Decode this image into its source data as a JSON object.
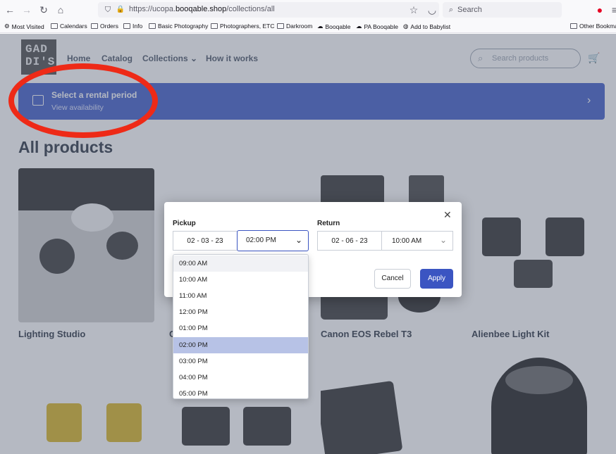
{
  "browser": {
    "url_prefix": "https://ucopa.",
    "url_domain": "booqable.shop",
    "url_path": "/collections/all",
    "search_placeholder": "Search",
    "bookmarks": [
      "Most Visited",
      "Calendars",
      "Orders",
      "Info",
      "Basic Photography",
      "Photographers, ETC",
      "Darkroom",
      "Booqable",
      "PA Booqable",
      "Add to Babylist",
      "Other Bookmar"
    ]
  },
  "site": {
    "logo_text": "GAD\nDI'S",
    "nav": [
      "Home",
      "Catalog",
      "Collections",
      "How it works"
    ],
    "search_placeholder": "Search products",
    "rental_title": "Select a rental period",
    "rental_sub": "View availability",
    "page_title": "All products",
    "products": [
      "Lighting Studio",
      "C",
      "Canon EOS Rebel T3",
      "Alienbee Light Kit"
    ]
  },
  "modal": {
    "pickup_label": "Pickup",
    "return_label": "Return",
    "pickup_date": "02 - 03 - 23",
    "pickup_time": "02:00 PM",
    "return_date": "02 - 06 - 23",
    "return_time": "10:00 AM",
    "cancel": "Cancel",
    "apply": "Apply",
    "time_options": [
      "09:00 AM",
      "10:00 AM",
      "11:00 AM",
      "12:00 PM",
      "01:00 PM",
      "02:00 PM",
      "03:00 PM",
      "04:00 PM",
      "05:00 PM"
    ],
    "selected_option": "02:00 PM"
  },
  "colors": {
    "accent": "#3b55c2",
    "annotation": "#ee2a17"
  }
}
